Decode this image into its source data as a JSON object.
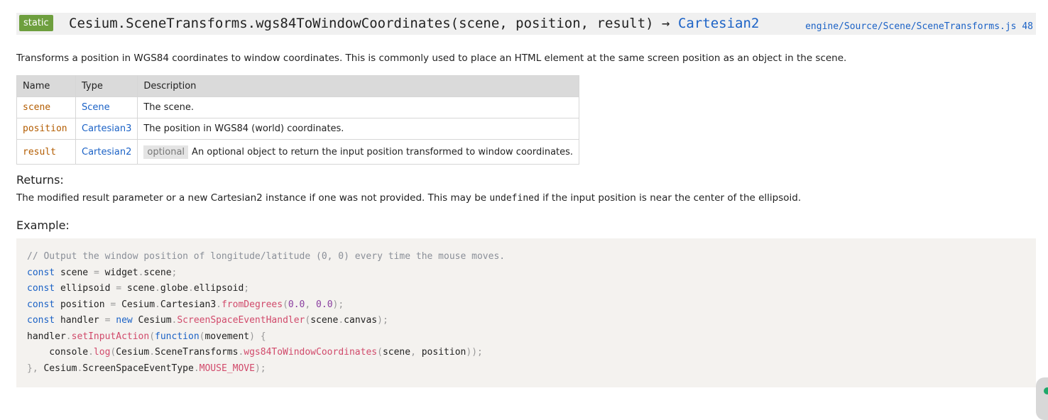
{
  "header": {
    "badge": "static",
    "signature": "Cesium.SceneTransforms.wgs84ToWindowCoordinates(scene, position, result) → ",
    "return_type": "Cartesian2",
    "source_link": "engine/Source/Scene/SceneTransforms.js 48"
  },
  "description": "Transforms a position in WGS84 coordinates to window coordinates. This is commonly used to place an HTML element at the same screen position as an object in the scene.",
  "params_table": {
    "headers": [
      "Name",
      "Type",
      "Description"
    ],
    "rows": [
      {
        "name": "scene",
        "type": "Scene",
        "optional": "",
        "desc": "The scene."
      },
      {
        "name": "position",
        "type": "Cartesian3",
        "optional": "",
        "desc": "The position in WGS84 (world) coordinates."
      },
      {
        "name": "result",
        "type": "Cartesian2",
        "optional": "optional",
        "desc": "An optional object to return the input position transformed to window coordinates."
      }
    ]
  },
  "returns": {
    "heading": "Returns:",
    "text_before": "The modified result parameter or a new Cartesian2 instance if one was not provided. This may be ",
    "code": "undefined",
    "text_after": " if the input position is near the center of the ellipsoid."
  },
  "example": {
    "heading": "Example:",
    "lines": [
      "// Output the window position of longitude/latitude (0, 0) every time the mouse moves.",
      "const scene = widget.scene;",
      "const ellipsoid = scene.globe.ellipsoid;",
      "const position = Cesium.Cartesian3.fromDegrees(0.0, 0.0);",
      "const handler = new Cesium.ScreenSpaceEventHandler(scene.canvas);",
      "handler.setInputAction(function(movement) {",
      "    console.log(Cesium.SceneTransforms.wgs84ToWindowCoordinates(scene, position));",
      "}, Cesium.ScreenSpaceEventType.MOUSE_MOVE);"
    ]
  },
  "colors": {
    "badge": "#6e9f3e",
    "link": "#1b62c6",
    "param_name": "#b35c00",
    "code_bg": "#f4f2ef"
  }
}
